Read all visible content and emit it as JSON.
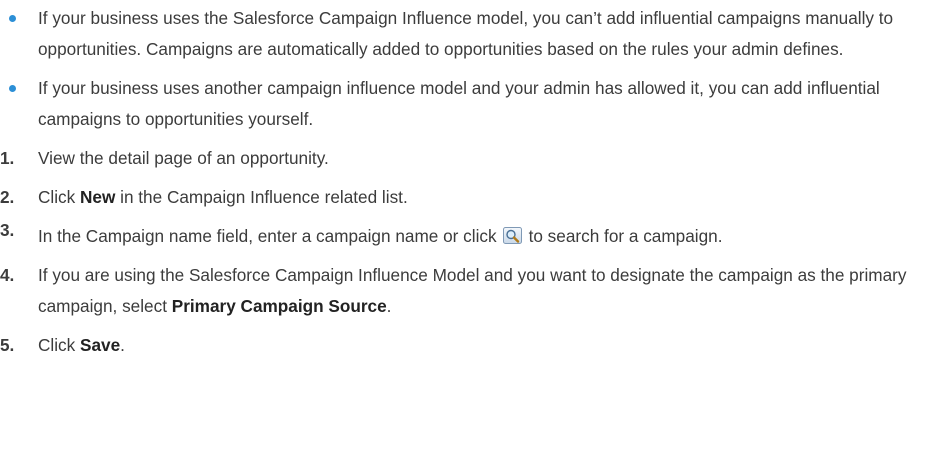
{
  "bullets": [
    {
      "text": "If your business uses the Salesforce Campaign Influence model, you can’t add influential campaigns manually to opportunities. Campaigns are automatically added to opportunities based on the rules your admin defines."
    },
    {
      "text": "If your business uses another campaign influence model and your admin has allowed it, you can add influential campaigns to opportunities yourself."
    }
  ],
  "steps": [
    {
      "num": "1.",
      "text": "View the detail page of an opportunity."
    },
    {
      "num": "2.",
      "pre": "Click ",
      "bold": "New",
      "post": " in the Campaign Influence related list."
    },
    {
      "num": "3.",
      "pre": "In the Campaign name field, enter a campaign name or click",
      "icon": "lookup-icon",
      "post": "to search for a campaign."
    },
    {
      "num": "4.",
      "pre": "If you are using the Salesforce Campaign Influence Model and you want to designate the campaign as the primary campaign, select ",
      "bold": "Primary Campaign Source",
      "post": "."
    },
    {
      "num": "5.",
      "pre": "Click ",
      "bold": "Save",
      "post": "."
    }
  ],
  "colors": {
    "bullet": "#2c8fd6",
    "text": "#3c3c3c"
  }
}
